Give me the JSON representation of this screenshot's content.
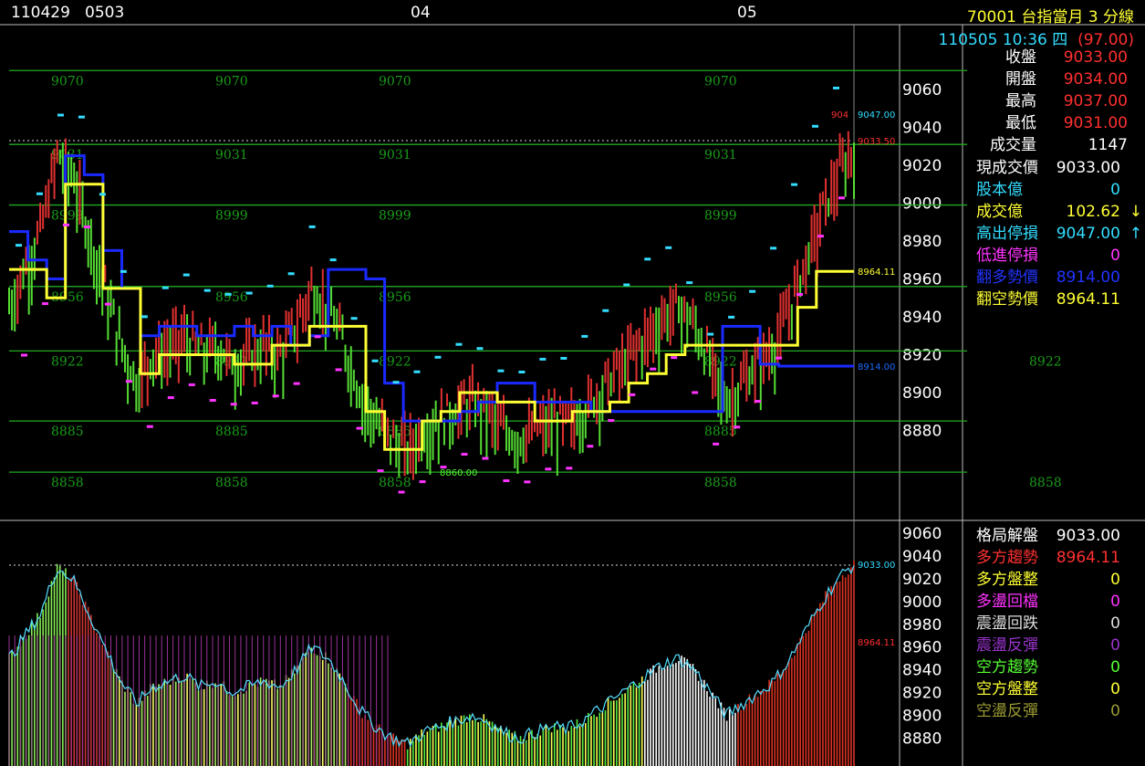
{
  "header": {
    "dates": [
      {
        "label": "110429"
      },
      {
        "label": "0503"
      },
      {
        "label": "04"
      },
      {
        "label": "05"
      }
    ],
    "title": "70001  台指當月 3 分線",
    "timestamp": "110505 10:36 四",
    "change": "(97.00)"
  },
  "colors": {
    "up": "#e03030",
    "down": "#55dd33",
    "blue_line": "#1a2aff",
    "yellow_line": "#ffff33",
    "level_line": "#22aa22"
  },
  "main_chart": {
    "y_ticks": [
      "9060",
      "9040",
      "9020",
      "9000",
      "8980",
      "8960",
      "8940",
      "8920",
      "8900",
      "8880"
    ],
    "levels": [
      {
        "label": "9070",
        "value": 9070
      },
      {
        "label": "9031",
        "value": 9031
      },
      {
        "label": "8999",
        "value": 8999
      },
      {
        "label": "8956",
        "value": 8956
      },
      {
        "label": "8922",
        "value": 8922
      },
      {
        "label": "8885",
        "value": 8885
      },
      {
        "label": "8858",
        "value": 8858
      }
    ],
    "tags": {
      "high_a": "904",
      "high_b": "9047.00",
      "last": "9033.50",
      "yellow_end": "8964.11",
      "blue_end": "8914.00",
      "low": "8860.00"
    }
  },
  "sub_chart": {
    "y_ticks": [
      "9060",
      "9040",
      "9020",
      "9000",
      "8980",
      "8960",
      "8940",
      "8920",
      "8900",
      "8880"
    ],
    "tags": {
      "last": "9033.00",
      "level": "8964.11"
    }
  },
  "quote_panel": [
    {
      "label": "收盤",
      "value": "9033.00",
      "label_color": "#ffffff",
      "value_color": "#ff3030"
    },
    {
      "label": "開盤",
      "value": "9034.00",
      "label_color": "#ffffff",
      "value_color": "#ff3030"
    },
    {
      "label": "最高",
      "value": "9037.00",
      "label_color": "#ffffff",
      "value_color": "#ff3030"
    },
    {
      "label": "最低",
      "value": "9031.00",
      "label_color": "#ffffff",
      "value_color": "#ff3030"
    },
    {
      "label": "成交量",
      "value": "1147",
      "label_color": "#ffffff",
      "value_color": "#ffffff"
    }
  ],
  "signal_panel": [
    {
      "label": "現成交價",
      "value": "9033.00",
      "label_color": "#ffffff",
      "value_color": "#ffffff",
      "arrow": ""
    },
    {
      "label": "股本億",
      "value": "0",
      "label_color": "#33ddff",
      "value_color": "#33ddff",
      "arrow": ""
    },
    {
      "label": "成交億",
      "value": "102.62",
      "label_color": "#ffff33",
      "value_color": "#ffff33",
      "arrow": "↓",
      "arrow_color": "#ffff33"
    },
    {
      "label": "高出停損",
      "value": "9047.00",
      "label_color": "#33ddff",
      "value_color": "#33ddff",
      "arrow": "↑",
      "arrow_color": "#33ddff"
    },
    {
      "label": "低進停損",
      "value": "0",
      "label_color": "#ff33ff",
      "value_color": "#ff33ff",
      "arrow": ""
    },
    {
      "label": "翻多勢價",
      "value": "8914.00",
      "label_color": "#2233ff",
      "value_color": "#2233ff",
      "arrow": ""
    },
    {
      "label": "翻空勢價",
      "value": "8964.11",
      "label_color": "#ffff33",
      "value_color": "#ffff33",
      "arrow": ""
    }
  ],
  "status_panel": [
    {
      "label": "格局解盤",
      "value": "9033.00",
      "label_color": "#ffffff",
      "value_color": "#ffffff"
    },
    {
      "label": "多方趨勢",
      "value": "8964.11",
      "label_color": "#ff3030",
      "value_color": "#ff3030"
    },
    {
      "label": "多方盤整",
      "value": "0",
      "label_color": "#ffff33",
      "value_color": "#ffff33"
    },
    {
      "label": "多盪回檔",
      "value": "0",
      "label_color": "#ff33ff",
      "value_color": "#ff33ff"
    },
    {
      "label": "震盪回跌",
      "value": "0",
      "label_color": "#dddddd",
      "value_color": "#dddddd"
    },
    {
      "label": "震盪反彈",
      "value": "0",
      "label_color": "#9933cc",
      "value_color": "#9933cc"
    },
    {
      "label": "空方趨勢",
      "value": "0",
      "label_color": "#55ff33",
      "value_color": "#55ff33"
    },
    {
      "label": "空方盤整",
      "value": "0",
      "label_color": "#ffff33",
      "value_color": "#ffff33"
    },
    {
      "label": "空盪反彈",
      "value": "0",
      "label_color": "#999933",
      "value_color": "#999933"
    }
  ],
  "chart_data": {
    "type": "line",
    "title": "70001  台指當月 3 分線",
    "x": [
      "110429",
      "0503",
      "04",
      "05"
    ],
    "ylim": [
      8850,
      9075
    ],
    "series": [
      {
        "values": [
          8950,
          8970,
          8990,
          9030,
          9020,
          8990,
          8960,
          8930,
          8910,
          8925,
          8930,
          8935,
          8925,
          8930,
          8920,
          8925,
          8930,
          8925,
          8940,
          8960,
          8950,
          8930,
          8905,
          8890,
          8880,
          8875,
          8885,
          8890,
          8895,
          8900,
          8895,
          8885,
          8880,
          8885,
          8890,
          8888,
          8895,
          8905,
          8915,
          8925,
          8935,
          8945,
          8950,
          8940,
          8920,
          8900,
          8910,
          8920,
          8930,
          8950,
          8975,
          9000,
          9020,
          9033
        ]
      },
      {
        "values": [
          8985,
          8970,
          8960,
          9025,
          9015,
          8975,
          8955,
          8930,
          8935,
          8935,
          8930,
          8930,
          8935,
          8930,
          8935,
          8925,
          8930,
          8965,
          8965,
          8960,
          8905,
          8885,
          8885,
          8885,
          8890,
          8895,
          8905,
          8905,
          8895,
          8895,
          8895,
          8890,
          8890,
          8890,
          8890,
          8890,
          8890,
          8890,
          8935,
          8935,
          8915,
          8914,
          8914,
          8914,
          8914
        ]
      },
      {
        "values": [
          8965,
          8965,
          8950,
          9010,
          9010,
          8955,
          8955,
          8910,
          8920,
          8920,
          8920,
          8920,
          8915,
          8915,
          8925,
          8925,
          8935,
          8935,
          8935,
          8890,
          8870,
          8870,
          8885,
          8890,
          8900,
          8900,
          8895,
          8895,
          8885,
          8885,
          8890,
          8890,
          8895,
          8905,
          8910,
          8920,
          8925,
          8925,
          8925,
          8925,
          8925,
          8925,
          8945,
          8964,
          8964
        ]
      }
    ]
  }
}
